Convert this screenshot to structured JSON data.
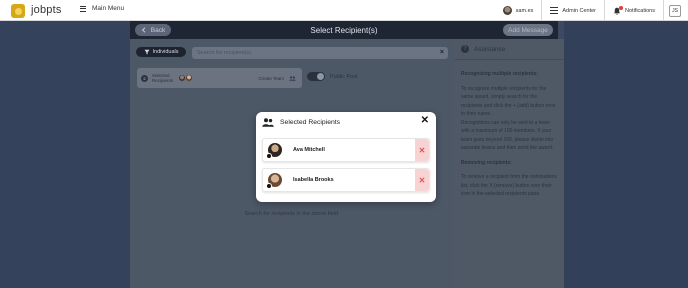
{
  "header": {
    "brand": "jobpts",
    "main_menu": "Main Menu",
    "user_name": "sam.es",
    "admin_center": "Admin Center",
    "notifications": "Notifications",
    "user_initials": "JS"
  },
  "subheader": {
    "title": "Select Recipient(s)",
    "back_label": "Back",
    "add_message_label": "Add Message"
  },
  "main": {
    "filter_label": "Individuals",
    "search_placeholder": "Search for recipient(s)",
    "selected_count": "2",
    "selected_label": "Selected Recipients",
    "create_team": "Create Team",
    "public_post": "Public Post",
    "hint": "Search for recipients in the above field."
  },
  "assistance": {
    "title": "Assistance",
    "section1_heading": "Recognizing multiple recipients:",
    "section1_text": "To recognize multiple recipients for the same award, simply search for the recipients and click the + (add) button next to their name.",
    "section1_text2": "Recognitions can only be sent to a team with a maximum of 100 members. If your team goes beyond 100, please divide into separate teams and then send the award.",
    "section2_heading": "Removing recipients:",
    "section2_text": "To remove a recipient from the nominations list, click the X (remove) button over their icon in the selected recipients pane."
  },
  "modal": {
    "title": "Selected Recipients",
    "recipients": [
      {
        "name": "Ava Mitchell"
      },
      {
        "name": "Isabella Brooks"
      }
    ]
  },
  "icons": [
    "logo-icon",
    "hamburger-icon",
    "sliders-icon",
    "bell-icon",
    "back-arrow-icon",
    "filter-icon",
    "close-icon",
    "team-icon",
    "people-icon",
    "remove-icon",
    "help-icon"
  ],
  "colors": {
    "accent": "#d6a717",
    "remove": "#e05555",
    "remove_bg": "#f8d3d3",
    "dark_bar": "#1e2634"
  }
}
